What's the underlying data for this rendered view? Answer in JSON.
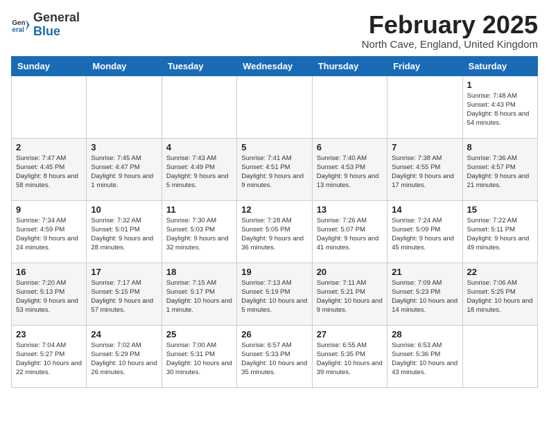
{
  "logo": {
    "general": "General",
    "blue": "Blue"
  },
  "title": "February 2025",
  "location": "North Cave, England, United Kingdom",
  "weekdays": [
    "Sunday",
    "Monday",
    "Tuesday",
    "Wednesday",
    "Thursday",
    "Friday",
    "Saturday"
  ],
  "weeks": [
    [
      {
        "day": "",
        "info": ""
      },
      {
        "day": "",
        "info": ""
      },
      {
        "day": "",
        "info": ""
      },
      {
        "day": "",
        "info": ""
      },
      {
        "day": "",
        "info": ""
      },
      {
        "day": "",
        "info": ""
      },
      {
        "day": "1",
        "info": "Sunrise: 7:48 AM\nSunset: 4:43 PM\nDaylight: 8 hours and 54 minutes."
      }
    ],
    [
      {
        "day": "2",
        "info": "Sunrise: 7:47 AM\nSunset: 4:45 PM\nDaylight: 8 hours and 58 minutes."
      },
      {
        "day": "3",
        "info": "Sunrise: 7:45 AM\nSunset: 4:47 PM\nDaylight: 9 hours and 1 minute."
      },
      {
        "day": "4",
        "info": "Sunrise: 7:43 AM\nSunset: 4:49 PM\nDaylight: 9 hours and 5 minutes."
      },
      {
        "day": "5",
        "info": "Sunrise: 7:41 AM\nSunset: 4:51 PM\nDaylight: 9 hours and 9 minutes."
      },
      {
        "day": "6",
        "info": "Sunrise: 7:40 AM\nSunset: 4:53 PM\nDaylight: 9 hours and 13 minutes."
      },
      {
        "day": "7",
        "info": "Sunrise: 7:38 AM\nSunset: 4:55 PM\nDaylight: 9 hours and 17 minutes."
      },
      {
        "day": "8",
        "info": "Sunrise: 7:36 AM\nSunset: 4:57 PM\nDaylight: 9 hours and 21 minutes."
      }
    ],
    [
      {
        "day": "9",
        "info": "Sunrise: 7:34 AM\nSunset: 4:59 PM\nDaylight: 9 hours and 24 minutes."
      },
      {
        "day": "10",
        "info": "Sunrise: 7:32 AM\nSunset: 5:01 PM\nDaylight: 9 hours and 28 minutes."
      },
      {
        "day": "11",
        "info": "Sunrise: 7:30 AM\nSunset: 5:03 PM\nDaylight: 9 hours and 32 minutes."
      },
      {
        "day": "12",
        "info": "Sunrise: 7:28 AM\nSunset: 5:05 PM\nDaylight: 9 hours and 36 minutes."
      },
      {
        "day": "13",
        "info": "Sunrise: 7:26 AM\nSunset: 5:07 PM\nDaylight: 9 hours and 41 minutes."
      },
      {
        "day": "14",
        "info": "Sunrise: 7:24 AM\nSunset: 5:09 PM\nDaylight: 9 hours and 45 minutes."
      },
      {
        "day": "15",
        "info": "Sunrise: 7:22 AM\nSunset: 5:11 PM\nDaylight: 9 hours and 49 minutes."
      }
    ],
    [
      {
        "day": "16",
        "info": "Sunrise: 7:20 AM\nSunset: 5:13 PM\nDaylight: 9 hours and 53 minutes."
      },
      {
        "day": "17",
        "info": "Sunrise: 7:17 AM\nSunset: 5:15 PM\nDaylight: 9 hours and 57 minutes."
      },
      {
        "day": "18",
        "info": "Sunrise: 7:15 AM\nSunset: 5:17 PM\nDaylight: 10 hours and 1 minute."
      },
      {
        "day": "19",
        "info": "Sunrise: 7:13 AM\nSunset: 5:19 PM\nDaylight: 10 hours and 5 minutes."
      },
      {
        "day": "20",
        "info": "Sunrise: 7:11 AM\nSunset: 5:21 PM\nDaylight: 10 hours and 9 minutes."
      },
      {
        "day": "21",
        "info": "Sunrise: 7:09 AM\nSunset: 5:23 PM\nDaylight: 10 hours and 14 minutes."
      },
      {
        "day": "22",
        "info": "Sunrise: 7:06 AM\nSunset: 5:25 PM\nDaylight: 10 hours and 18 minutes."
      }
    ],
    [
      {
        "day": "23",
        "info": "Sunrise: 7:04 AM\nSunset: 5:27 PM\nDaylight: 10 hours and 22 minutes."
      },
      {
        "day": "24",
        "info": "Sunrise: 7:02 AM\nSunset: 5:29 PM\nDaylight: 10 hours and 26 minutes."
      },
      {
        "day": "25",
        "info": "Sunrise: 7:00 AM\nSunset: 5:31 PM\nDaylight: 10 hours and 30 minutes."
      },
      {
        "day": "26",
        "info": "Sunrise: 6:57 AM\nSunset: 5:33 PM\nDaylight: 10 hours and 35 minutes."
      },
      {
        "day": "27",
        "info": "Sunrise: 6:55 AM\nSunset: 5:35 PM\nDaylight: 10 hours and 39 minutes."
      },
      {
        "day": "28",
        "info": "Sunrise: 6:53 AM\nSunset: 5:36 PM\nDaylight: 10 hours and 43 minutes."
      },
      {
        "day": "",
        "info": ""
      }
    ]
  ]
}
